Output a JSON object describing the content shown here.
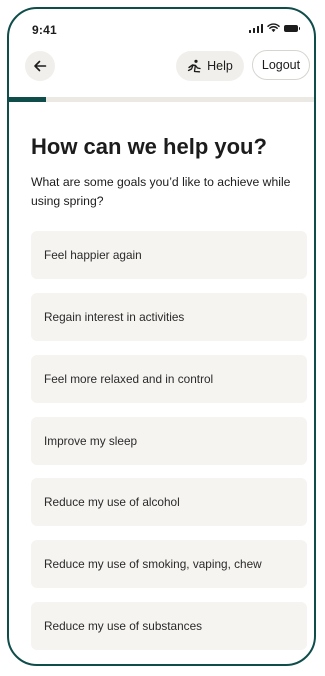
{
  "status_bar": {
    "time": "9:41"
  },
  "header": {
    "help_label": "Help",
    "logout_label": "Logout"
  },
  "progress": {
    "fraction": 0.12
  },
  "title": "How can we help you?",
  "subtitle": "What are some goals you’d like to achieve while using spring?",
  "options": [
    "Feel happier again",
    "Regain interest in activities",
    "Feel more relaxed and in control",
    "Improve my sleep",
    "Reduce my use of alcohol",
    "Reduce my use of smoking, vaping, chew",
    "Reduce my use of substances"
  ],
  "colors": {
    "accent": "#0f4d4a",
    "option_bg": "#f6f4f1",
    "button_bg": "#f1efeb"
  },
  "icons": {
    "back": "arrow-left-icon",
    "help": "person-help-icon"
  }
}
